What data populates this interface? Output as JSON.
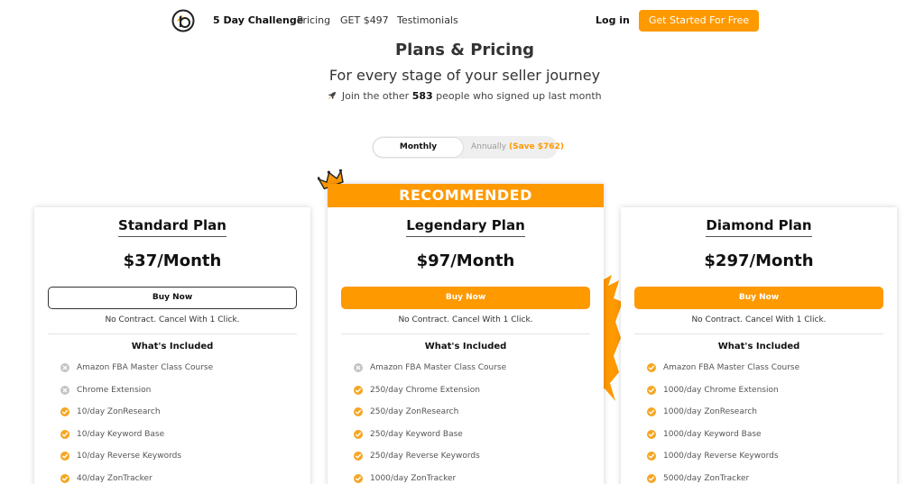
{
  "nav": {
    "links": [
      "5 Day Challenge",
      "Pricing",
      "GET $497",
      "Testimonials"
    ],
    "login": "Log in",
    "cta": "Get Started For Free"
  },
  "hero": {
    "title": "Plans & Pricing",
    "subtitle": "For every stage of your seller journey",
    "join_prefix": "Join the other",
    "join_count": "583",
    "join_suffix": "people who signed up last month"
  },
  "billing_toggle": {
    "monthly": "Monthly",
    "annually": "Annually",
    "annual_save": "(Save $762)",
    "selected": "Monthly"
  },
  "plans": [
    {
      "name": "Standard Plan",
      "price": "$37/Month",
      "button": "Buy Now",
      "note": "No Contract. Cancel With 1 Click.",
      "included_title": "What's Included",
      "features": [
        {
          "text": "Amazon FBA Master Class Course",
          "included": false
        },
        {
          "text": "Chrome Extension",
          "included": false
        },
        {
          "text": "10/day ZonResearch",
          "included": true
        },
        {
          "text": "10/day Keyword Base",
          "included": true
        },
        {
          "text": "10/day Reverse Keywords",
          "included": true
        },
        {
          "text": "40/day ZonTracker",
          "included": true
        }
      ]
    },
    {
      "badge": "RECOMMENDED",
      "name": "Legendary Plan",
      "price": "$97/Month",
      "button": "Buy Now",
      "note": "No Contract. Cancel With 1 Click.",
      "included_title": "What's Included",
      "features": [
        {
          "text": "Amazon FBA Master Class Course",
          "included": false
        },
        {
          "text": "250/day Chrome Extension",
          "included": true
        },
        {
          "text": "250/day ZonResearch",
          "included": true
        },
        {
          "text": "250/day Keyword Base",
          "included": true
        },
        {
          "text": "250/day Reverse Keywords",
          "included": true
        },
        {
          "text": "1000/day ZonTracker",
          "included": true
        }
      ]
    },
    {
      "name": "Diamond Plan",
      "price": "$297/Month",
      "button": "Buy Now",
      "note": "No Contract. Cancel With 1 Click.",
      "included_title": "What's Included",
      "features": [
        {
          "text": "Amazon FBA Master Class Course",
          "included": true
        },
        {
          "text": "1000/day Chrome Extension",
          "included": true
        },
        {
          "text": "1000/day ZonResearch",
          "included": true
        },
        {
          "text": "1000/day Keyword Base",
          "included": true
        },
        {
          "text": "1000/day Reverse Keywords",
          "included": true
        },
        {
          "text": "5000/day ZonTracker",
          "included": true
        }
      ]
    }
  ],
  "colors": {
    "accent": "#ff9900",
    "check": "#f5a623",
    "cross": "#c4c4c4"
  },
  "icons": [
    "logo-icon",
    "rocket-icon",
    "crown-icon",
    "check-icon",
    "cross-icon"
  ]
}
